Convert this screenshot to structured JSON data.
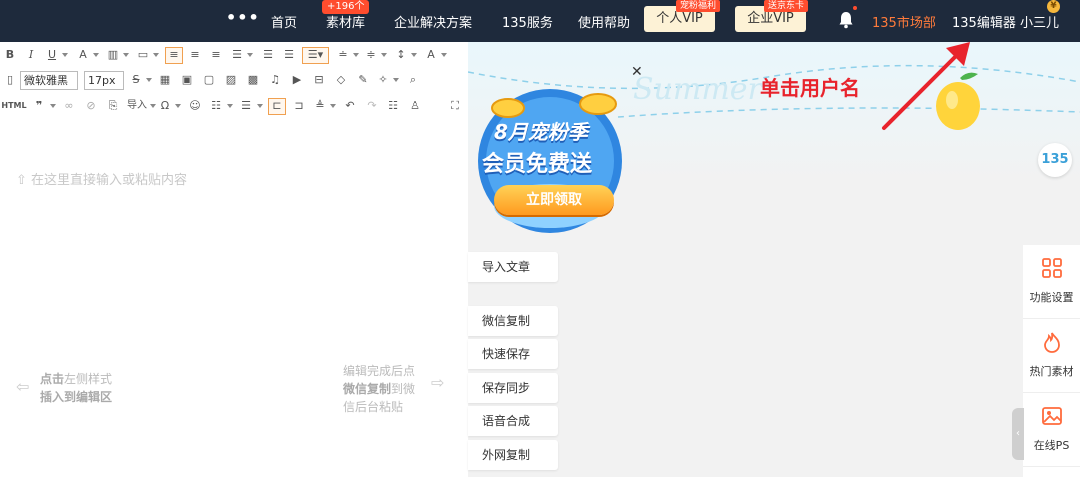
{
  "topnav": {
    "items": [
      {
        "label": "首页"
      },
      {
        "label": "素材库",
        "badge": "+196个"
      },
      {
        "label": "企业解决方案"
      },
      {
        "label": "135服务"
      },
      {
        "label": "使用帮助"
      }
    ],
    "vip_personal": {
      "label": "个人VIP",
      "badge": "宠粉福利"
    },
    "vip_enterprise": {
      "label": "企业VIP",
      "badge": "送京东卡"
    },
    "market": "135市场部",
    "user": "135编辑器 小三儿",
    "bg_color": "#1e2a3c"
  },
  "editor": {
    "font_family": "微软雅黑",
    "font_size": "17px",
    "html_label": "HTML",
    "import_label": "导入",
    "placeholder": "在这里直接输入或粘贴内容",
    "hint_left_bold1": "点击",
    "hint_left_text1": "左侧样式",
    "hint_left_bold2": "插入到编辑区",
    "hint_right_text1": "编辑完成后点",
    "hint_right_bold": "微信复制",
    "hint_right_text2": "到微",
    "hint_right_text3": "信后台粘贴"
  },
  "promo": {
    "title1": "8月宠粉季",
    "title2": "会员免费送",
    "button": "立即领取",
    "bg_word": "Summer"
  },
  "annotation": "单击用户名",
  "side_buttons": [
    "导入文章",
    "微信复制",
    "快速保存",
    "保存同步",
    "语音合成",
    "外网复制"
  ],
  "rail": [
    {
      "label": "功能设置",
      "icon": "grid-icon"
    },
    {
      "label": "热门素材",
      "icon": "flame-icon"
    },
    {
      "label": "在线PS",
      "icon": "image-icon"
    }
  ],
  "logo_text": "135",
  "accent_color": "#ff7b3b",
  "annotation_color": "#e8232c"
}
